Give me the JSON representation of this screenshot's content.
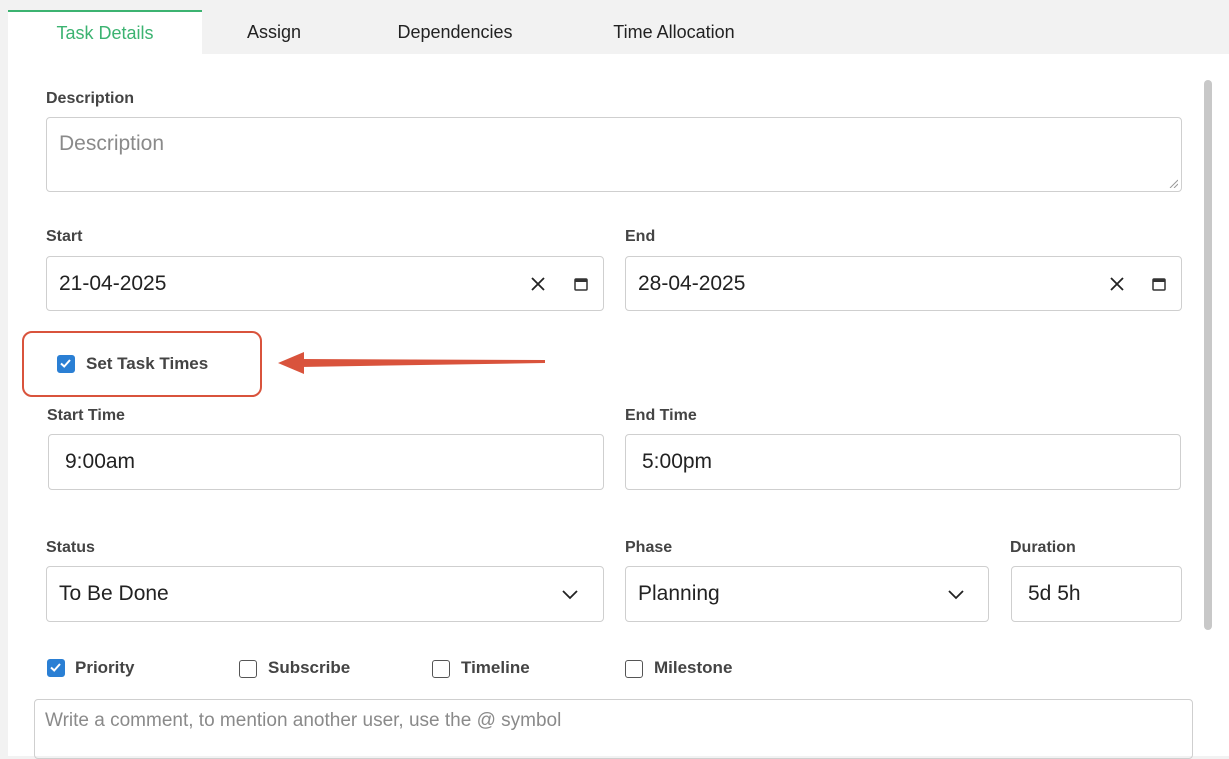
{
  "tabs": {
    "task_details": "Task Details",
    "assign": "Assign",
    "dependencies": "Dependencies",
    "time_allocation": "Time Allocation"
  },
  "description": {
    "label": "Description",
    "placeholder": "Description"
  },
  "start": {
    "label": "Start",
    "value": "21-04-2025"
  },
  "end": {
    "label": "End",
    "value": "28-04-2025"
  },
  "set_task_times": {
    "label": "Set Task Times",
    "checked": true
  },
  "start_time": {
    "label": "Start Time",
    "value": "9:00am"
  },
  "end_time": {
    "label": "End Time",
    "value": "5:00pm"
  },
  "status": {
    "label": "Status",
    "value": "To Be Done"
  },
  "phase": {
    "label": "Phase",
    "value": "Planning"
  },
  "duration": {
    "label": "Duration",
    "value": "5d 5h"
  },
  "options": {
    "priority": {
      "label": "Priority",
      "checked": true
    },
    "subscribe": {
      "label": "Subscribe",
      "checked": false
    },
    "timeline": {
      "label": "Timeline",
      "checked": false
    },
    "milestone": {
      "label": "Milestone",
      "checked": false
    }
  },
  "comment": {
    "placeholder": "Write a comment, to mention another user, use the @ symbol"
  },
  "colors": {
    "accent_green": "#3cb371",
    "checkbox_blue": "#2a7fd4",
    "annotation_red": "#d9533c"
  },
  "icons": [
    "clear-icon",
    "calendar-icon",
    "chevron-down-icon",
    "checkbox-checked-icon",
    "arrow-annotation"
  ]
}
